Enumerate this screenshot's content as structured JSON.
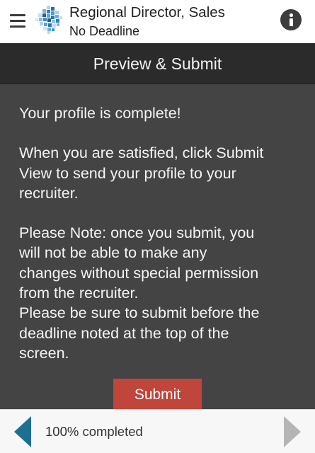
{
  "header": {
    "title": "Regional Director, Sales",
    "subtitle": "No Deadline",
    "menu_icon": "hamburger-menu-icon",
    "logo_icon": "mosaic-logo",
    "info_icon": "info-icon"
  },
  "section": {
    "title": "Preview & Submit"
  },
  "content": {
    "line1": "Your profile is complete!",
    "para2_line1": "When you are satisfied, click Submit",
    "para2_line2": "View to send your profile to your",
    "para2_line3": "recruiter.",
    "para3_line1": "Please Note: once you submit, you",
    "para3_line2": "will not be able to make any",
    "para3_line3": "changes without special permission",
    "para3_line4": "from the recruiter.",
    "para3_line5": "Please be sure to submit before the",
    "para3_line6": "deadline noted at the top of the",
    "para3_line7": "screen."
  },
  "submit_button": {
    "label": "Submit"
  },
  "footer": {
    "progress": "100% completed",
    "progress_value": 1.0,
    "prev_icon": "previous-arrow-icon",
    "next_icon": "next-arrow-icon"
  },
  "colors": {
    "header_bg": "#ffffff",
    "section_bar_bg": "#2b2b2b",
    "content_bg": "#444444",
    "submit_bg": "#c0453a",
    "prev_arrow": "#1f6f93",
    "next_arrow": "#b5b5b5",
    "footer_bg": "#f7f7f7"
  }
}
